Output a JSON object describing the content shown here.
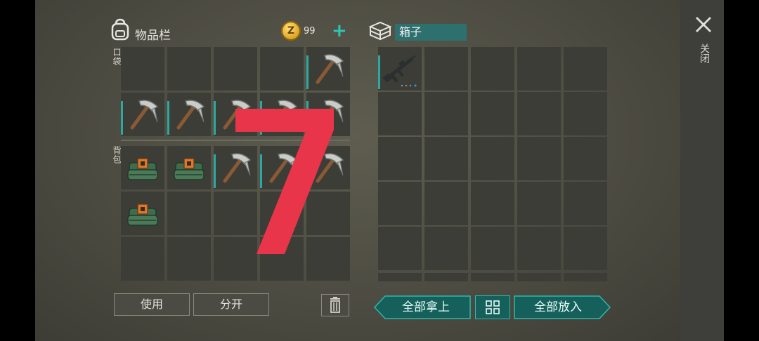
{
  "inventory": {
    "title": "物品栏",
    "coin_symbol": "Z",
    "coin_count": "99",
    "add_label": "+",
    "pocket_label": "口袋",
    "backpack_label": "背包"
  },
  "box": {
    "title": "箱子"
  },
  "buttons": {
    "use": "使用",
    "split": "分开",
    "take_all": "全部拿上",
    "put_all": "全部放入"
  },
  "close_label": "关闭",
  "overlay_number": "7",
  "colors": {
    "accent": "#2aa8a1",
    "teal_button": "#15605b",
    "overlay": "#e8354a"
  },
  "slots": {
    "pocket": [
      "empty",
      "empty",
      "empty",
      "empty",
      "pickaxe",
      "pickaxe",
      "pickaxe",
      "pickaxe",
      "pickaxe",
      "pickaxe"
    ],
    "backpack": [
      "explosive",
      "explosive",
      "pickaxe",
      "pickaxe",
      "pickaxe",
      "explosive",
      "empty",
      "empty",
      "empty",
      "empty",
      "empty",
      "empty",
      "empty",
      "empty",
      "empty"
    ],
    "box": [
      "rifle"
    ]
  }
}
